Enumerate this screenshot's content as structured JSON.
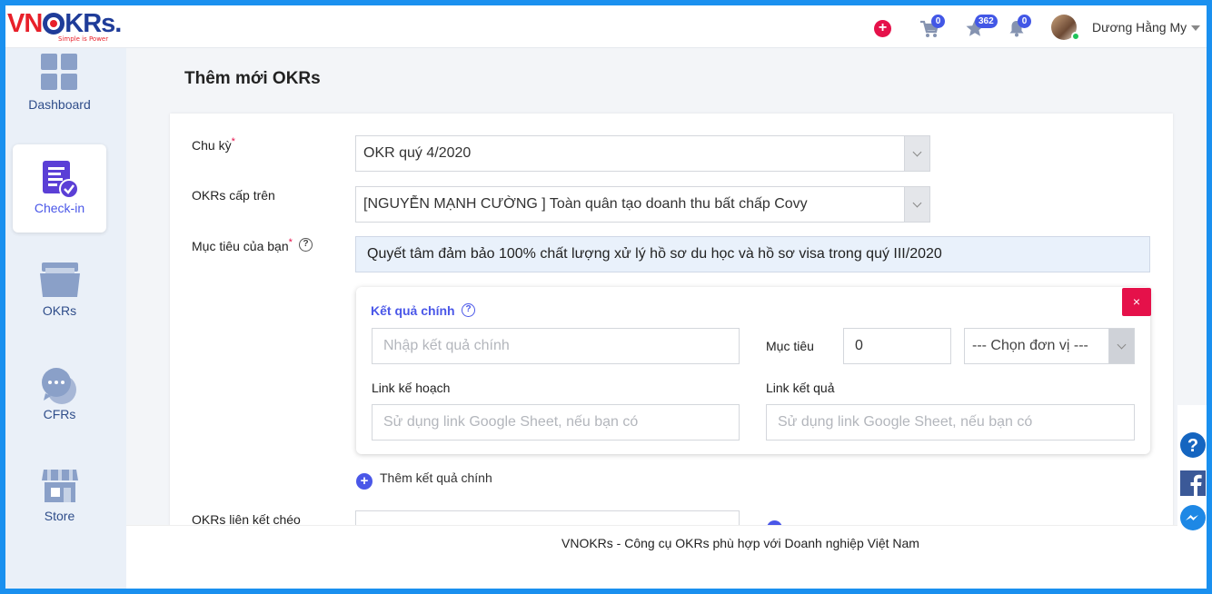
{
  "brand": {
    "logo_vn": "VN",
    "logo_okrs": "KRs.",
    "tagline": "Simple is Power"
  },
  "header": {
    "cart_count": "0",
    "star_count": "362",
    "notif_count": "0",
    "user_name": "Dương Hằng My"
  },
  "sidebar": {
    "items": [
      {
        "label": "Dashboard",
        "icon": "dashboard-icon"
      },
      {
        "label": "Check-in",
        "icon": "checkin-icon"
      },
      {
        "label": "OKRs",
        "icon": "folder-icon"
      },
      {
        "label": "CFRs",
        "icon": "chat-icon"
      },
      {
        "label": "Store",
        "icon": "store-icon"
      }
    ]
  },
  "page": {
    "title": "Thêm mới OKRs"
  },
  "form": {
    "cycle_label": "Chu kỳ",
    "cycle_value": "OKR quý 4/2020",
    "parent_label": "OKRs cấp trên",
    "parent_value": "[NGUYỄN MẠNH CƯỜNG ] Toàn quân tạo doanh thu bất chấp Covy",
    "goal_label": "Mục tiêu của bạn",
    "goal_value": "Quyết tâm đảm bảo 100% chất lượng  xử lý hồ sơ du học và hồ sơ visa trong quý III/2020",
    "key_result": {
      "title": "Kết quả chính",
      "name_placeholder": "Nhập kết quả chính",
      "target_label": "Mục tiêu",
      "target_value": "0",
      "unit_placeholder": "--- Chọn đơn vị ---",
      "plan_link_label": "Link kế hoạch",
      "plan_link_placeholder": "Sử dụng link Google Sheet, nếu bạn có",
      "result_link_label": "Link kết quả",
      "result_link_placeholder": "Sử dụng link Google Sheet, nếu bạn có",
      "close_symbol": "×"
    },
    "add_key_result": "Thêm kết quả chính",
    "cross_link_label": "OKRs liên kết chéo"
  },
  "footer": {
    "text": "VNOKRs - Công cụ OKRs phù hợp với Doanh nghiệp Việt Nam"
  },
  "colors": {
    "accent": "#4a57e8",
    "danger": "#e5114a",
    "frame": "#1a90ef"
  }
}
